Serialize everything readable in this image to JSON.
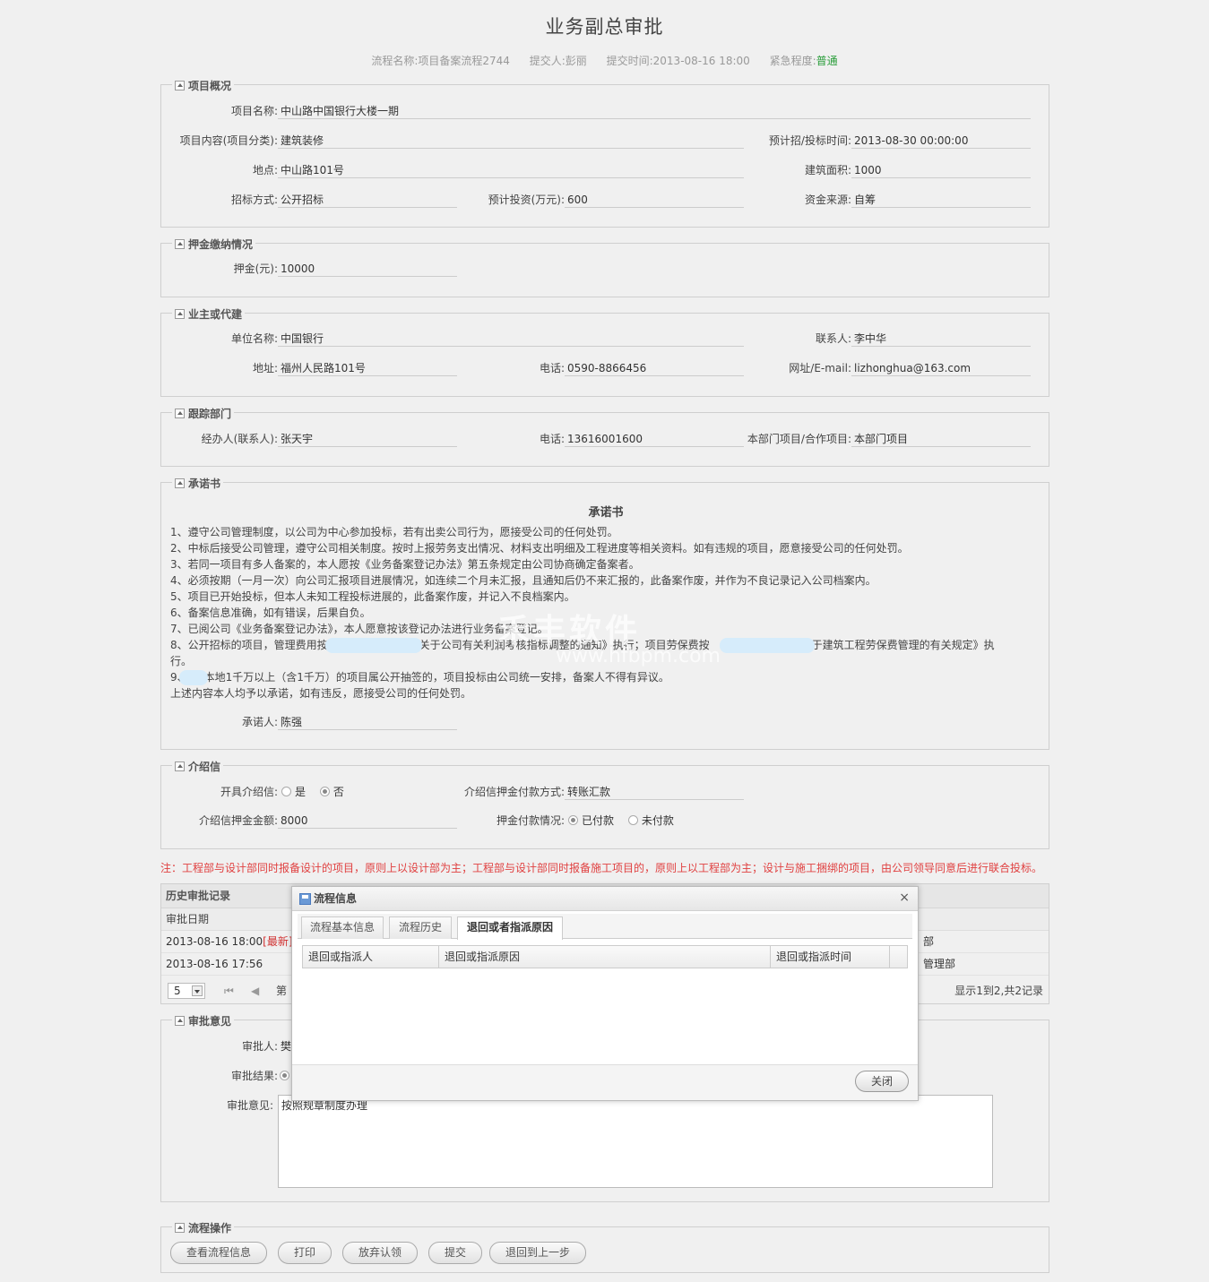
{
  "page": {
    "title": "业务副总审批",
    "meta": {
      "flow_name": "流程名称:项目备案流程2744",
      "submitter": "提交人:彭丽",
      "submit_time": "提交时间:2013-08-16 18:00",
      "urgency_label": "紧急程度:",
      "urgency_value": "普通"
    }
  },
  "colors": {
    "urgency": "#2a9d3a",
    "note": "#e04040",
    "latest": "#d03030"
  },
  "overview": {
    "legend": "项目概况",
    "name_label": "项目名称:",
    "name_value": "中山路中国银行大楼一期",
    "content_label": "项目内容(项目分类):",
    "content_value": "建筑装修",
    "bid_time_label": "预计招/投标时间:",
    "bid_time_value": "2013-08-30 00:00:00",
    "location_label": "地点:",
    "location_value": "中山路101号",
    "area_label": "建筑面积:",
    "area_value": "1000",
    "method_label": "招标方式:",
    "method_value": "公开招标",
    "invest_label": "预计投资(万元):",
    "invest_value": "600",
    "fund_label": "资金来源:",
    "fund_value": "自筹"
  },
  "deposit": {
    "legend": "押金缴纳情况",
    "label": "押金(元):",
    "value": "10000"
  },
  "owner": {
    "legend": "业主或代建",
    "unit_label": "单位名称:",
    "unit_value": "中国银行",
    "contact_label": "联系人:",
    "contact_value": "李中华",
    "address_label": "地址:",
    "address_value": "福州人民路101号",
    "phone_label": "电话:",
    "phone_value": "0590-8866456",
    "web_label": "网址/E-mail:",
    "web_value": "lizhonghua@163.com"
  },
  "tracking": {
    "legend": "跟踪部门",
    "handler_label": "经办人(联系人):",
    "handler_value": "张天宇",
    "phone_label": "电话:",
    "phone_value": "13616001600",
    "type_label": "本部门项目/合作项目:",
    "type_value": "本部门项目"
  },
  "pledge": {
    "legend": "承诺书",
    "title": "承诺书",
    "lines": [
      "1、遵守公司管理制度，以公司为中心参加投标，若有出卖公司行为，愿接受公司的任何处罚。",
      "2、中标后接受公司管理，遵守公司相关制度。按时上报劳务支出情况、材料支出明细及工程进度等相关资料。如有违规的项目，愿意接受公司的任何处罚。",
      "3、若同一项目有多人备案的，本人愿按《业务备案登记办法》第五条规定由公司协商确定备案者。",
      "4、必须按期（一月一次）向公司汇报项目进展情况，如连续二个月未汇报，且通知后仍不来汇报的，此备案作废，并作为不良记录记入公司档案内。",
      "5、项目已开始投标，但本人未知工程投标进展的，此备案作废，并记入不良档案内。",
      "6、备案信息准确，如有错误，后果自负。",
      "7、已阅公司《业务备案登记办法》，本人愿意按该登记办法进行业务备案登记。",
      "8、公开招标的项目，管理费用按　　　　　　　　《关于公司有关利润考核指标调整的通知》执行；项目劳保费按　　　　　　　　《关于建筑工程劳保费管理的有关规定》执",
      "行。",
      "9、　　本地1千万以上（含1千万）的项目属公开抽签的，项目投标由公司统一安排，备案人不得有异议。",
      "上述内容本人均予以承诺，如有违反，愿接受公司的任何处罚。"
    ],
    "signer_label": "承诺人:",
    "signer_value": "陈强"
  },
  "intro": {
    "legend": "介绍信",
    "issue_label": "开具介绍信:",
    "yes": "是",
    "no": "否",
    "pay_method_label": "介绍信押金付款方式:",
    "pay_method_value": "转账汇款",
    "amount_label": "介绍信押金金额:",
    "amount_value": "8000",
    "pay_status_label": "押金付款情况:",
    "paid": "已付款",
    "unpaid": "未付款"
  },
  "note": "注：工程部与设计部同时报备设计的项目，原则上以设计部为主；工程部与设计部同时报备施工项目的，原则上以工程部为主；设计与施工捆绑的项目，由公司领导同意后进行联合投标。",
  "history": {
    "title": "历史审批记录",
    "col_date": "审批日期",
    "rows": [
      {
        "date": "2013-08-16 18:00",
        "tag": "[最新]",
        "dept": "部"
      },
      {
        "date": "2013-08-16 17:56",
        "tag": "",
        "dept": "管理部"
      }
    ],
    "page_size": "5",
    "page_prefix": "第",
    "info": "显示1到2,共2记录"
  },
  "approval": {
    "legend": "审批意见",
    "approver_label": "审批人:",
    "approver_value": "樊",
    "result_label": "审批结果:",
    "opinion_label": "审批意见:",
    "opinion_value": "按照规章制度办理"
  },
  "ops": {
    "legend": "流程操作",
    "buttons": [
      "查看流程信息",
      "打印",
      "放弃认领",
      "提交",
      "退回到上一步"
    ]
  },
  "dialog": {
    "title": "流程信息",
    "close_x": "×",
    "tabs": [
      "流程基本信息",
      "流程历史",
      "退回或者指派原因"
    ],
    "columns": [
      "退回或指派人",
      "退回或指派原因",
      "退回或指派时间"
    ],
    "close_button": "关闭"
  },
  "watermark": {
    "cn": "禾丰软件",
    "url": "www.hfbpm.com"
  }
}
